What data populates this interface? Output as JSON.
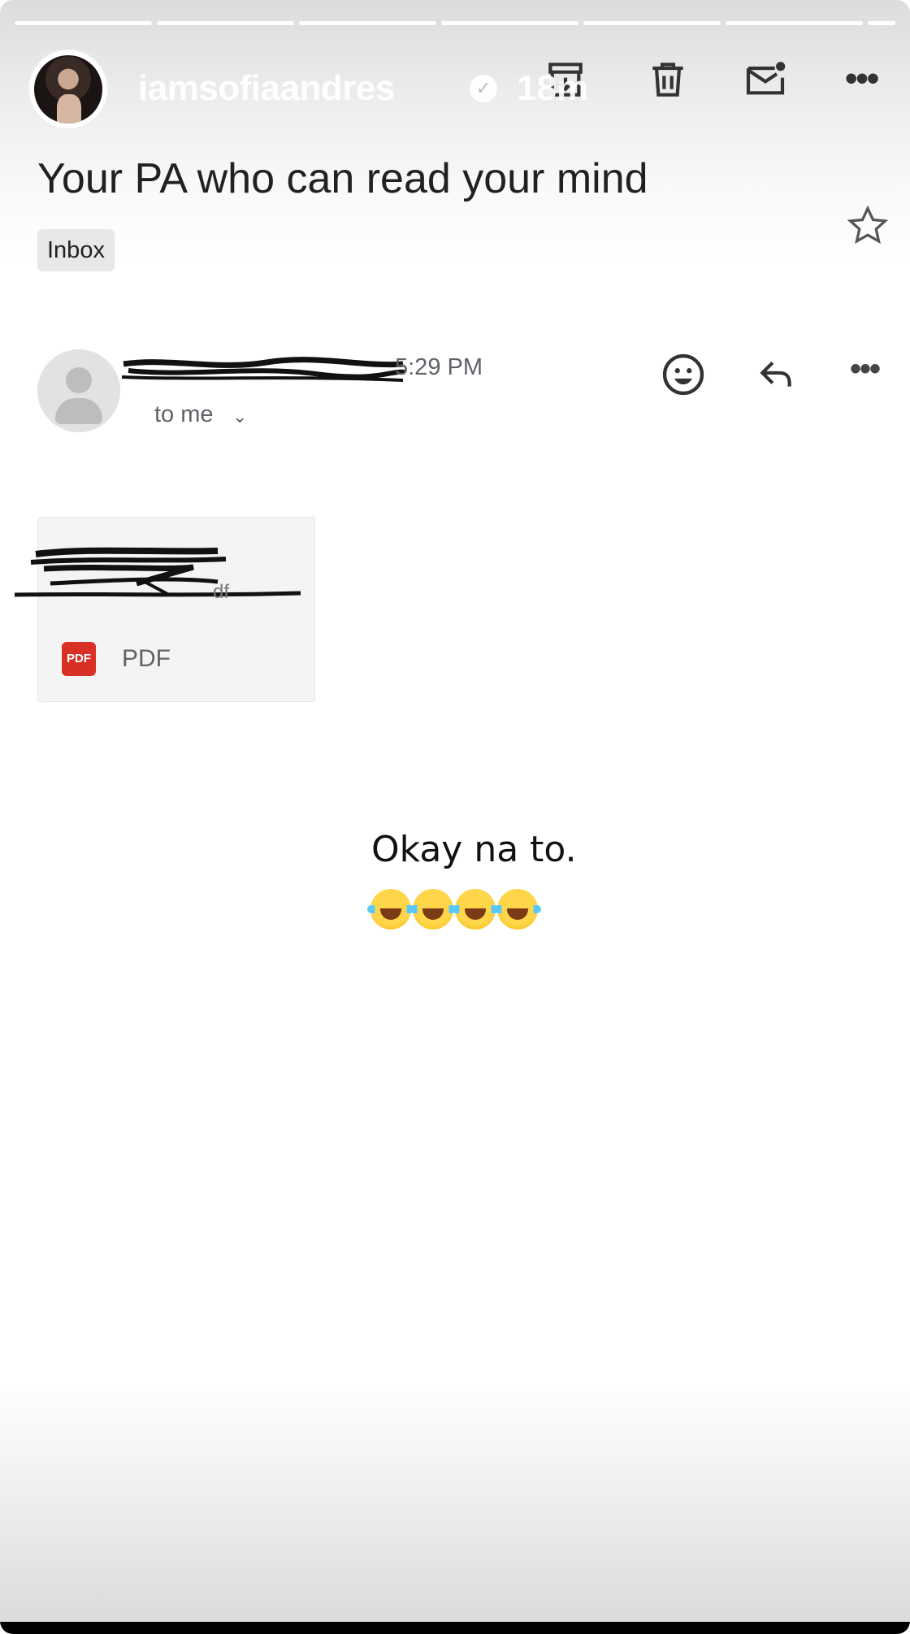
{
  "story": {
    "username": "iamsofiaandres",
    "verified_glyph": "✓",
    "time": "18m",
    "menu_glyph": "•••",
    "progress_segments": 7,
    "progress_fraction_current": 0.2
  },
  "email": {
    "subject": "Your PA who can read your mind",
    "label": "Inbox",
    "sender_time": "5:29 PM",
    "recipient": "to me",
    "recipient_chevron": "⌄",
    "more_glyph": "•••",
    "attachment": {
      "badge": "PDF",
      "type": "PDF"
    },
    "body_text": "Okay na to.",
    "emoji_reaction": "😂😂😂😂"
  },
  "icons": {
    "archive": "archive-icon",
    "trash": "trash-icon",
    "mark_unread": "mark-unread-icon",
    "star": "star-icon",
    "emoji": "emoji-react-icon",
    "reply": "reply-icon"
  },
  "colors": {
    "pdf_red": "#d93025",
    "text_primary": "#202124",
    "text_secondary": "#5f6368"
  }
}
